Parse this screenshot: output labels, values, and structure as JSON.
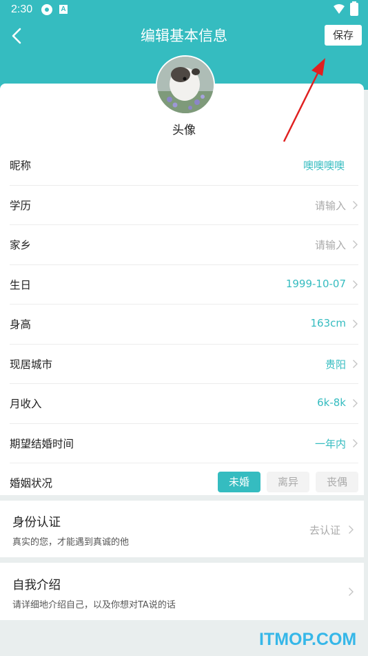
{
  "status_bar": {
    "time": "2:30",
    "badge_letter": "A"
  },
  "header": {
    "title": "编辑基本信息",
    "save_label": "保存"
  },
  "avatar": {
    "label": "头像"
  },
  "fields": [
    {
      "label": "昵称",
      "value": "噢噢噢噢",
      "value_style": "teal",
      "chevron": false
    },
    {
      "label": "学历",
      "value": "请输入",
      "value_style": "grey",
      "chevron": true
    },
    {
      "label": "家乡",
      "value": "请输入",
      "value_style": "grey",
      "chevron": true
    },
    {
      "label": "生日",
      "value": "1999-10-07",
      "value_style": "teal",
      "chevron": true
    },
    {
      "label": "身高",
      "value": "163cm",
      "value_style": "teal",
      "chevron": true
    },
    {
      "label": "现居城市",
      "value": "贵阳",
      "value_style": "teal",
      "chevron": true
    },
    {
      "label": "月收入",
      "value": "6k-8k",
      "value_style": "teal",
      "chevron": true
    },
    {
      "label": "期望结婚时间",
      "value": "一年内",
      "value_style": "teal",
      "chevron": true
    }
  ],
  "marital": {
    "label": "婚姻状况",
    "options": [
      "未婚",
      "离异",
      "丧偶"
    ],
    "selected": "未婚"
  },
  "verify": {
    "title": "身份认证",
    "subtitle": "真实的您，才能遇到真诚的他",
    "value": "去认证"
  },
  "intro": {
    "title": "自我介绍",
    "subtitle": "请详细地介绍自己，以及你想对TA说的话"
  },
  "watermark": "ITMOP.COM",
  "colors": {
    "accent": "#35bcc0",
    "arrow": "#e02020",
    "watermark": "#36b7e8"
  }
}
